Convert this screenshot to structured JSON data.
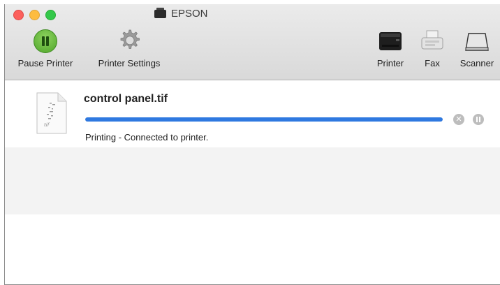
{
  "window": {
    "title": "EPSON"
  },
  "toolbar": {
    "pause_label": "Pause Printer",
    "settings_label": "Printer Settings",
    "printer_label": "Printer",
    "fax_label": "Fax",
    "scanner_label": "Scanner"
  },
  "job": {
    "filename": "control panel.tif",
    "status": "Printing - Connected to printer.",
    "progress": 1.0,
    "file_icon_text": "tif"
  },
  "colors": {
    "progress": "#2f79e0",
    "pause_button": "#4fa52a"
  }
}
